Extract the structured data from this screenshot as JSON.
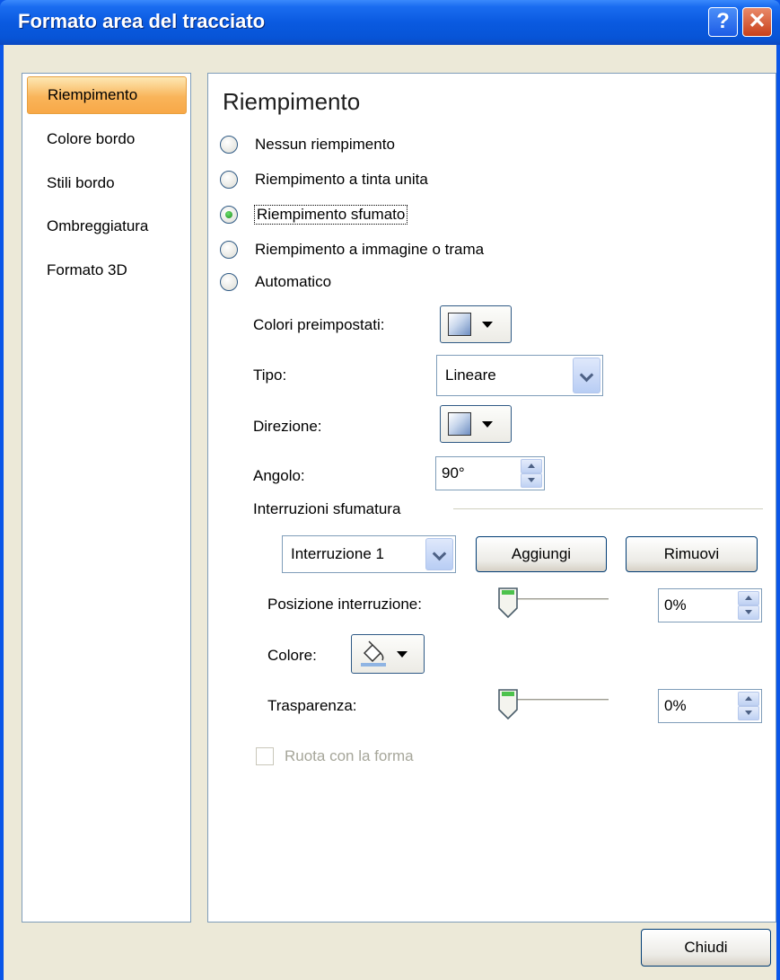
{
  "window": {
    "title": "Formato area del tracciato",
    "help_glyph": "?",
    "close_glyph": "✕"
  },
  "nav": {
    "items": [
      {
        "label": "Riempimento",
        "selected": true
      },
      {
        "label": "Colore bordo",
        "selected": false
      },
      {
        "label": "Stili bordo",
        "selected": false
      },
      {
        "label": "Ombreggiatura",
        "selected": false
      },
      {
        "label": "Formato 3D",
        "selected": false
      }
    ]
  },
  "panel": {
    "heading": "Riempimento",
    "fill_options": [
      {
        "label": "Nessun riempimento",
        "checked": false
      },
      {
        "label": "Riempimento a tinta unita",
        "checked": false
      },
      {
        "label": "Riempimento sfumato",
        "checked": true
      },
      {
        "label": "Riempimento a immagine o trama",
        "checked": false
      },
      {
        "label": "Automatico",
        "checked": false
      }
    ],
    "preset_colors_label": "Colori preimpostati:",
    "type_label": "Tipo:",
    "type_value": "Lineare",
    "direction_label": "Direzione:",
    "angle_label": "Angolo:",
    "angle_value": "90°",
    "stops_group_label": "Interruzioni sfumatura",
    "stop_select_value": "Interruzione 1",
    "add_button": "Aggiungi",
    "remove_button": "Rimuovi",
    "stop_position_label": "Posizione interruzione:",
    "stop_position_value": "0%",
    "color_label": "Colore:",
    "transparency_label": "Trasparenza:",
    "transparency_value": "0%",
    "rotate_with_shape_label": "Ruota con la forma",
    "rotate_with_shape_checked": false,
    "rotate_with_shape_enabled": false
  },
  "footer": {
    "close_button": "Chiudi"
  },
  "colors": {
    "titlebar": "#0a56e8",
    "dialog_bg": "#ece9d8",
    "selected_nav": "#f9b45a",
    "field_border": "#7f9db9"
  }
}
